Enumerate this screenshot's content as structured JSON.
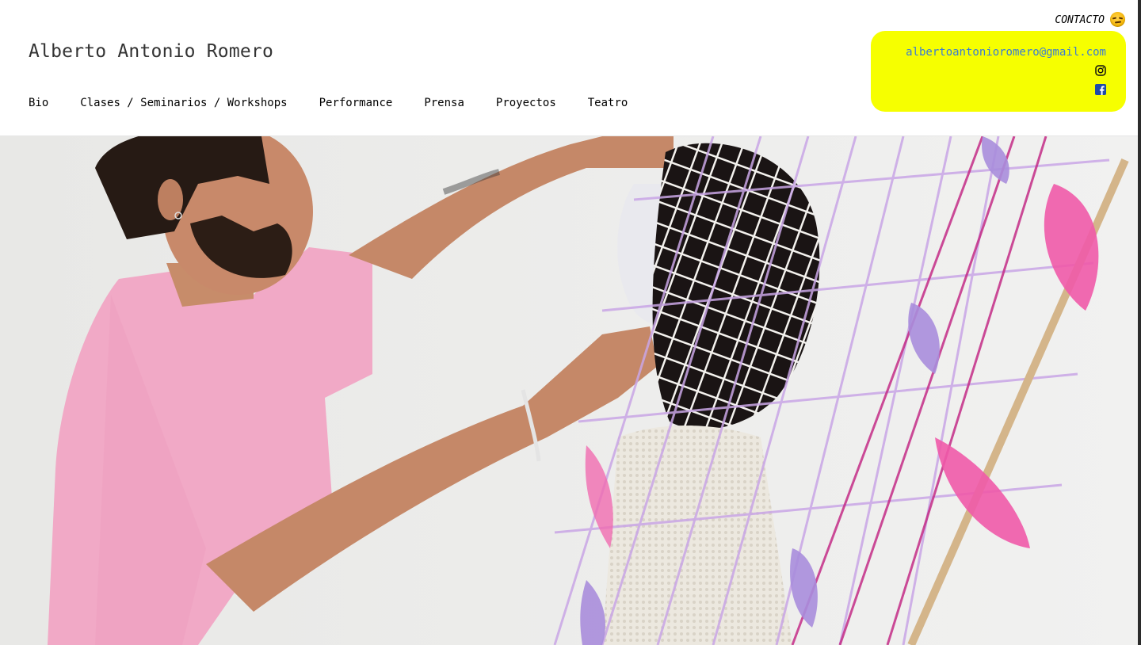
{
  "site": {
    "title": "Alberto Antonio Romero"
  },
  "nav": {
    "items": [
      {
        "label": "Bio"
      },
      {
        "label": "Clases / Seminarios / Workshops"
      },
      {
        "label": "Performance"
      },
      {
        "label": "Prensa"
      },
      {
        "label": "Proyectos"
      },
      {
        "label": "Teatro"
      }
    ]
  },
  "contact": {
    "label": "CONTACTO",
    "emoji_icon": "smirking-face-icon",
    "email": "albertoantonioromero@gmail.com",
    "instagram_icon": "instagram-icon",
    "facebook_icon": "facebook-icon",
    "box_color": "#f6ff00",
    "email_color": "#3a7bd5"
  },
  "hero": {
    "image": "artist-adjusting-crochet-net-mask-photo"
  }
}
